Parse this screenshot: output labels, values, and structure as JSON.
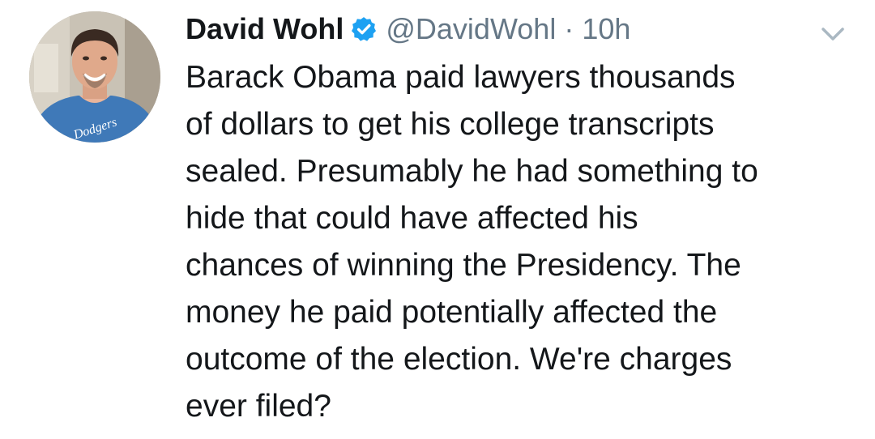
{
  "tweet": {
    "author": {
      "name": "David Wohl",
      "handle": "@DavidWohl",
      "verified": true
    },
    "separator": "·",
    "time": "10h",
    "text_lines": [
      "Barack Obama paid lawyers thousands",
      "of dollars to get his college transcripts",
      "sealed. Presumably he had something to",
      "hide that could have affected his",
      "chances of winning the Presidency. The",
      "money he paid potentially affected the",
      "outcome of the election. We're charges",
      "ever filed?"
    ],
    "avatar_shirt_text": "Dodgers"
  },
  "icons": {
    "verified": "verified-badge-icon",
    "menu": "chevron-down-icon"
  },
  "colors": {
    "text": "#14171a",
    "secondary": "#657786",
    "verified_blue": "#1da1f2",
    "chevron": "#aab8c2"
  }
}
